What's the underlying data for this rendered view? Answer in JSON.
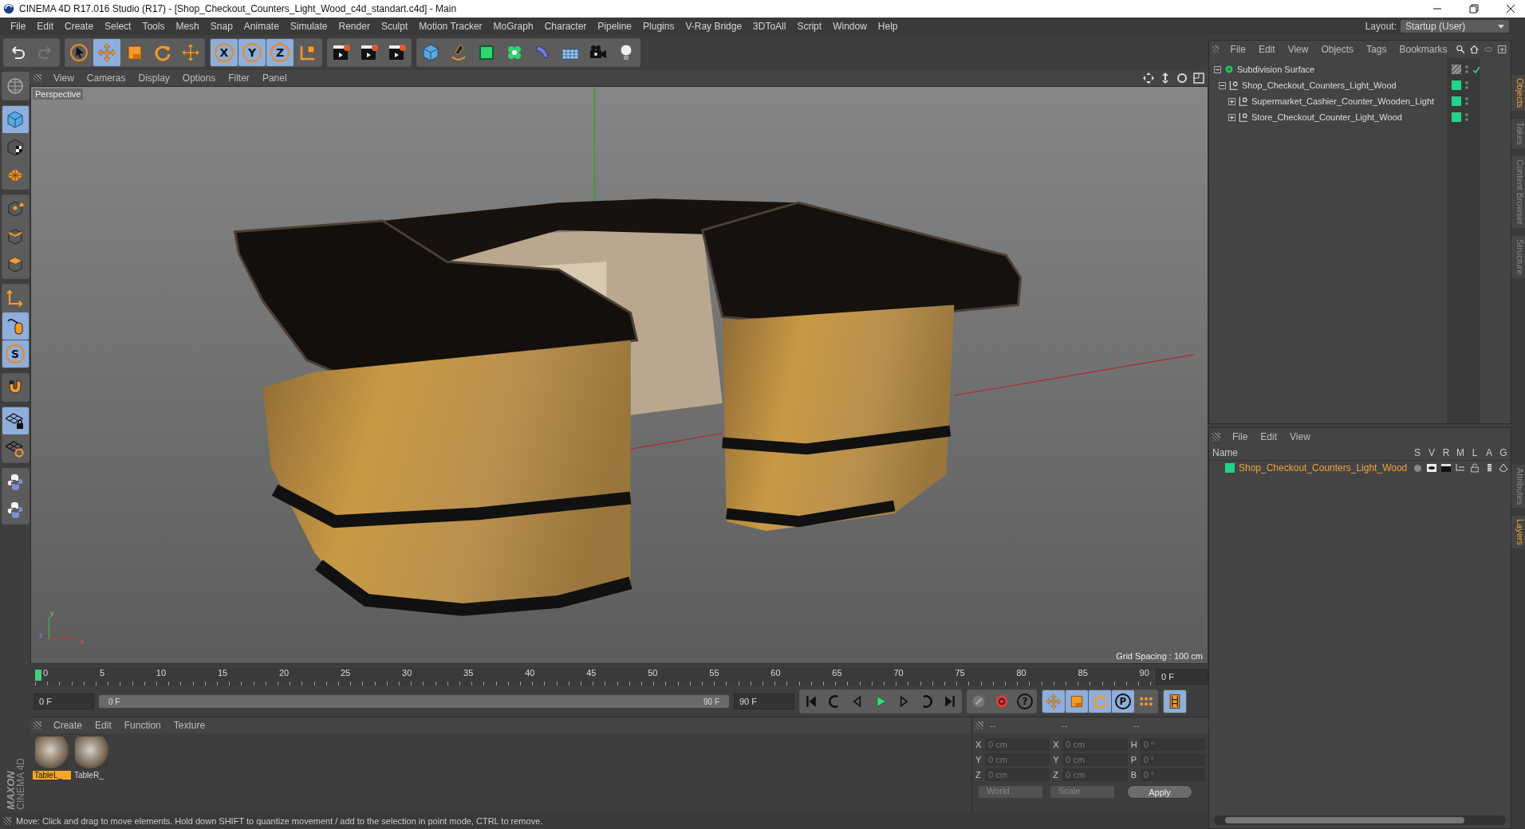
{
  "window": {
    "title": "CINEMA 4D R17.016 Studio (R17) - [Shop_Checkout_Counters_Light_Wood_c4d_standart.c4d] - Main"
  },
  "menu": [
    "File",
    "Edit",
    "Create",
    "Select",
    "Tools",
    "Mesh",
    "Snap",
    "Animate",
    "Simulate",
    "Render",
    "Sculpt",
    "Motion Tracker",
    "MoGraph",
    "Character",
    "Pipeline",
    "Plugins",
    "V-Ray Bridge",
    "3DToAll",
    "Script",
    "Window",
    "Help"
  ],
  "layout": {
    "label": "Layout:",
    "value": "Startup (User)"
  },
  "toolbar": [
    [
      {
        "kind": "undo",
        "selected": false
      },
      {
        "kind": "redo",
        "selected": false
      }
    ],
    [
      {
        "kind": "cursor",
        "selected": false
      },
      {
        "kind": "move",
        "selected": true
      },
      {
        "kind": "scale",
        "selected": false
      },
      {
        "kind": "rotate",
        "selected": false
      },
      {
        "kind": "cross",
        "selected": false
      }
    ],
    [
      {
        "kind": "letter",
        "label": "X",
        "selected": true
      },
      {
        "kind": "letter",
        "label": "Y",
        "selected": true
      },
      {
        "kind": "letter",
        "label": "Z",
        "selected": true
      },
      {
        "kind": "coord",
        "selected": false
      }
    ],
    [
      {
        "kind": "clapper",
        "selected": false
      },
      {
        "kind": "clapper",
        "selected": false
      },
      {
        "kind": "clapper",
        "selected": false
      }
    ],
    [
      {
        "kind": "cube",
        "selected": false
      },
      {
        "kind": "pen",
        "selected": false
      },
      {
        "kind": "greencube",
        "selected": false
      },
      {
        "kind": "cluster",
        "selected": false
      },
      {
        "kind": "bend",
        "selected": false
      },
      {
        "kind": "floor",
        "selected": false
      },
      {
        "kind": "camera",
        "selected": false
      },
      {
        "kind": "bulb",
        "selected": false
      }
    ]
  ],
  "left_tools": [
    [
      {
        "kind": "globe",
        "selected": false
      }
    ],
    [
      {
        "kind": "cube",
        "selected": true
      },
      {
        "kind": "checker",
        "selected": false
      },
      {
        "kind": "grid",
        "selected": false
      }
    ],
    [
      {
        "kind": "points",
        "selected": false
      },
      {
        "kind": "edges",
        "selected": false
      },
      {
        "kind": "polygons",
        "selected": false
      }
    ],
    [
      {
        "kind": "axes",
        "selected": false
      },
      {
        "kind": "mouse",
        "selected": true
      },
      {
        "kind": "letter",
        "label": "S",
        "selected": true
      }
    ],
    [
      {
        "kind": "magnet",
        "selected": false
      }
    ],
    [
      {
        "kind": "gridlock",
        "selected": true
      },
      {
        "kind": "gridcycle",
        "selected": false
      }
    ],
    [
      {
        "kind": "snake",
        "selected": false
      },
      {
        "kind": "snake",
        "selected": false
      }
    ]
  ],
  "logo": {
    "brand": "MAXON",
    "product": "CINEMA 4D"
  },
  "viewport": {
    "menu": [
      "View",
      "Cameras",
      "Display",
      "Options",
      "Filter",
      "Panel"
    ],
    "camera": "Perspective",
    "grid_spacing": "Grid Spacing : 100 cm",
    "gizmo": [
      "y",
      "z",
      "x"
    ]
  },
  "timeline": {
    "ticks": [
      "0",
      "5",
      "10",
      "15",
      "20",
      "25",
      "30",
      "35",
      "40",
      "45",
      "50",
      "55",
      "60",
      "65",
      "70",
      "75",
      "80",
      "85",
      "90"
    ],
    "level": 0,
    "current": "0 F",
    "start": "0 F",
    "range": {
      "start": "0 F",
      "end": "90 F",
      "level": 1
    },
    "end": "90 F",
    "buttons": [
      [
        {
          "kind": "first",
          "selected": false
        },
        {
          "kind": "prevkey",
          "selected": false
        },
        {
          "kind": "prev",
          "selected": false
        },
        {
          "kind": "play",
          "selected": false
        },
        {
          "kind": "next",
          "selected": false
        },
        {
          "kind": "nextkey",
          "selected": false
        },
        {
          "kind": "last",
          "selected": false
        }
      ],
      [
        {
          "kind": "link",
          "selected": false
        },
        {
          "kind": "record",
          "selected": false
        },
        {
          "kind": "letter",
          "label": "?",
          "selected": false
        }
      ],
      [
        {
          "kind": "cross",
          "selected": true
        },
        {
          "kind": "scale",
          "selected": true
        },
        {
          "kind": "rotate",
          "selected": true
        },
        {
          "kind": "letter",
          "label": "P",
          "selected": true
        },
        {
          "kind": "dots",
          "selected": false
        }
      ],
      [
        {
          "kind": "film",
          "selected": true
        }
      ]
    ]
  },
  "materials": {
    "menu": [
      "Create",
      "Edit",
      "Function",
      "Texture"
    ],
    "items": [
      {
        "name": "TableL_",
        "selected": true
      },
      {
        "name": "TableR_",
        "selected": false
      }
    ]
  },
  "coordinates": {
    "headers": [
      "--",
      "--",
      "--"
    ],
    "columns": [
      [
        {
          "label": "X",
          "value": "0 cm"
        },
        {
          "label": "Y",
          "value": "0 cm"
        },
        {
          "label": "Z",
          "value": "0 cm"
        }
      ],
      [
        {
          "label": "X",
          "value": "0 cm"
        },
        {
          "label": "Y",
          "value": "0 cm"
        },
        {
          "label": "Z",
          "value": "0 cm"
        }
      ],
      [
        {
          "label": "H",
          "value": "0 °"
        },
        {
          "label": "P",
          "value": "0 °"
        },
        {
          "label": "B",
          "value": "0 °"
        }
      ]
    ],
    "dropdowns": [
      "World",
      "Scale"
    ],
    "apply": "Apply"
  },
  "object_manager": {
    "menu": [
      "File",
      "Edit",
      "View",
      "Objects",
      "Tags",
      "Bookmarks"
    ],
    "objects": [
      {
        "name": "Subdivision Surface",
        "kind": "subdivision",
        "expanded": true,
        "checked": true,
        "children": [
          {
            "name": "Shop_Checkout_Counters_Light_Wood",
            "kind": "null",
            "expanded": true,
            "checked": false,
            "color": "#22d38f",
            "children": [
              {
                "name": "Supermarket_Cashier_Counter_Wooden_Light",
                "kind": "null",
                "expanded": false,
                "checked": false,
                "color": "#22d38f"
              },
              {
                "name": "Store_Checkout_Counter_Light_Wood",
                "kind": "null",
                "expanded": false,
                "checked": false,
                "color": "#22d38f"
              }
            ]
          }
        ]
      }
    ]
  },
  "layer_manager": {
    "menu": [
      "File",
      "Edit",
      "View"
    ],
    "columns": [
      "Name",
      "S",
      "V",
      "R",
      "M",
      "L",
      "A",
      "G"
    ],
    "layers": [
      {
        "name": "Shop_Checkout_Counters_Light_Wood",
        "color": "#22d38f"
      }
    ]
  },
  "side_tabs": {
    "top": [
      {
        "label": "Objects",
        "selected": true
      },
      {
        "label": "Takes",
        "selected": false
      },
      {
        "label": "Content Browser",
        "selected": false
      },
      {
        "label": "Structure",
        "selected": false
      }
    ],
    "bottom": [
      {
        "label": "Attributes",
        "selected": false
      },
      {
        "label": "Layers",
        "selected": true
      }
    ]
  },
  "status": "Move: Click and drag to move elements. Hold down SHIFT to quantize movement / add to the selection in point mode, CTRL to remove."
}
